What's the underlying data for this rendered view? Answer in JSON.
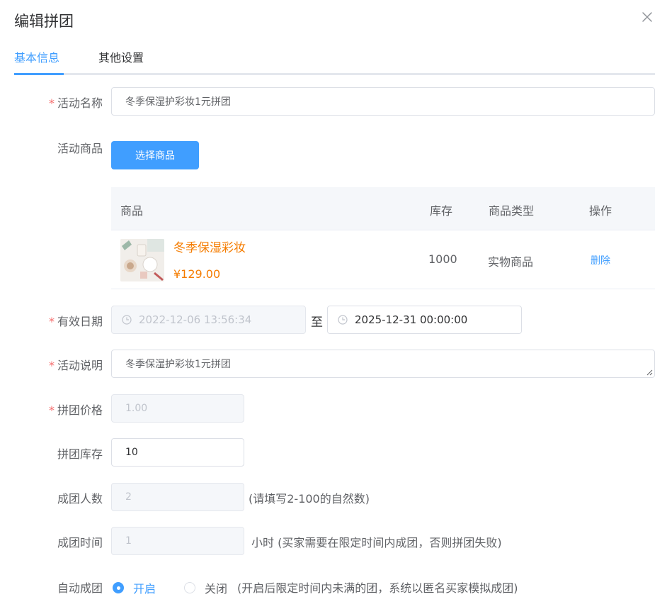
{
  "dialog": {
    "title": "编辑拼团"
  },
  "tabs": [
    {
      "label": "基本信息"
    },
    {
      "label": "其他设置"
    }
  ],
  "form": {
    "activity_name": {
      "label": "活动名称",
      "value": "冬季保湿护彩妆1元拼团"
    },
    "activity_goods": {
      "label": "活动商品",
      "button": "选择商品"
    },
    "goods_table": {
      "headers": [
        "商品",
        "库存",
        "商品类型",
        "操作"
      ],
      "rows": [
        {
          "name": "冬季保湿彩妆",
          "price": "¥129.00",
          "stock": "1000",
          "type": "实物商品",
          "action": "删除"
        }
      ]
    },
    "valid_date": {
      "label": "有效日期",
      "start": "2022-12-06 13:56:34",
      "separator": "至",
      "end": "2025-12-31 00:00:00"
    },
    "description": {
      "label": "活动说明",
      "value": "冬季保湿护彩妆1元拼团"
    },
    "group_price": {
      "label": "拼团价格",
      "value": "1.00"
    },
    "group_stock": {
      "label": "拼团库存",
      "value": "10"
    },
    "group_size": {
      "label": "成团人数",
      "value": "2",
      "hint": "(请填写2-100的自然数)"
    },
    "group_time": {
      "label": "成团时间",
      "value": "1",
      "hint": "小时 (买家需要在限定时间内成团，否则拼团失败)"
    },
    "auto_group": {
      "label": "自动成团",
      "on_label": "开启",
      "off_label": "关闭",
      "hint": "(开启后限定时间内未满的团，系统以匿名买家模拟成团)",
      "selected": "on"
    }
  },
  "colors": {
    "primary": "#409eff",
    "danger": "#f56c6c",
    "price": "#f57c00"
  }
}
